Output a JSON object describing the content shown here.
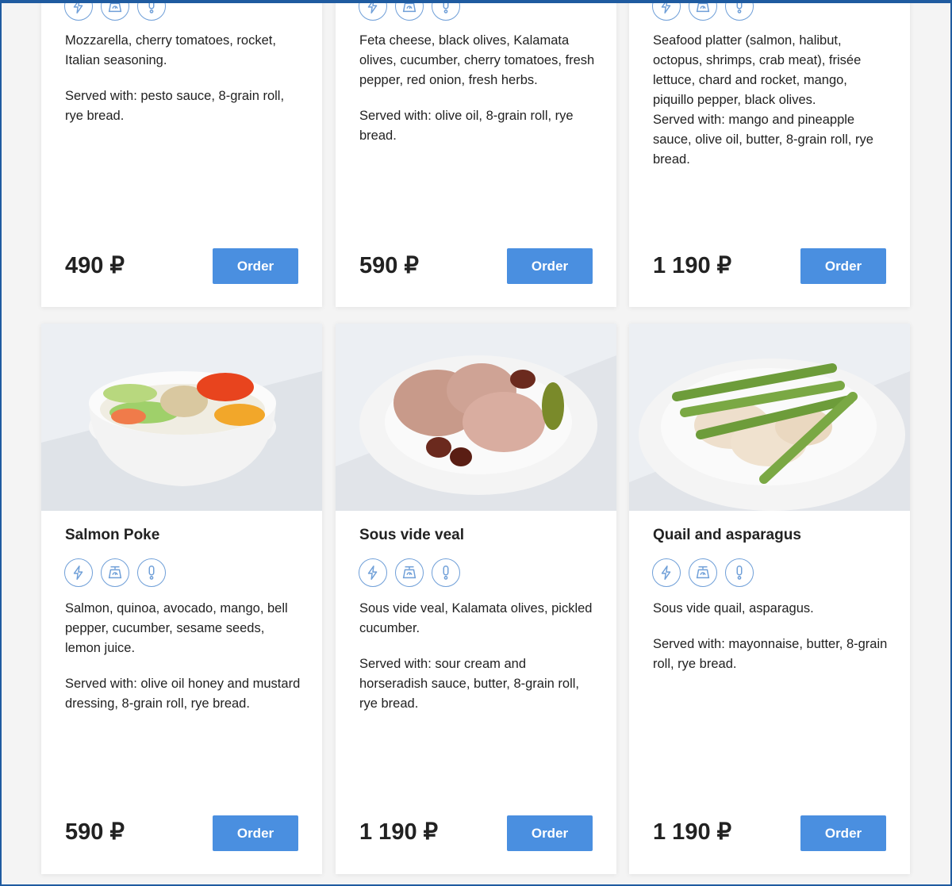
{
  "currency": "₽",
  "icon_names": [
    "lightning-icon",
    "scale-icon",
    "exclamation-icon"
  ],
  "colors": {
    "accent": "#4a8fe0",
    "icon_stroke": "#6f9fd8",
    "frame": "#1f5ba0"
  },
  "cards": [
    {
      "title": "",
      "description": "Mozzarella, cherry tomatoes, rocket, Italian seasoning.",
      "served": "Served with: pesto sauce, 8-grain roll, rye bread.",
      "price": "490 ₽",
      "button": "Order"
    },
    {
      "title": "",
      "description": "Feta cheese, black olives, Kalamata olives, cucumber, cherry tomatoes, fresh pepper, red onion, fresh herbs.",
      "served": "Served with: olive oil, 8-grain roll, rye bread.",
      "price": "590 ₽",
      "button": "Order"
    },
    {
      "title": "",
      "description": "Seafood platter (salmon, halibut, octopus, shrimps, crab meat), frisée lettuce, chard and rocket, mango, piquillo pepper, black olives.",
      "served": "Served with: mango and pineapple sauce, olive oil, butter, 8-grain roll, rye bread.",
      "price": "1 190 ₽",
      "button": "Order"
    },
    {
      "title": "Salmon Poke",
      "description": "Salmon, quinoa, avocado, mango, bell pepper, cucumber, sesame seeds, lemon juice.",
      "served": "Served with: olive oil honey and mustard dressing, 8-grain roll, rye bread.",
      "price": "590 ₽",
      "button": "Order"
    },
    {
      "title": "Sous vide veal",
      "description": "Sous vide veal, Kalamata olives, pickled cucumber.",
      "served": "Served with: sour cream and horseradish sauce, butter, 8-grain roll, rye bread.",
      "price": "1 190 ₽",
      "button": "Order"
    },
    {
      "title": "Quail and asparagus",
      "description": "Sous vide quail, asparagus.",
      "served": "Served with: mayonnaise, butter, 8-grain roll, rye bread.",
      "price": "1 190 ₽",
      "button": "Order"
    }
  ]
}
